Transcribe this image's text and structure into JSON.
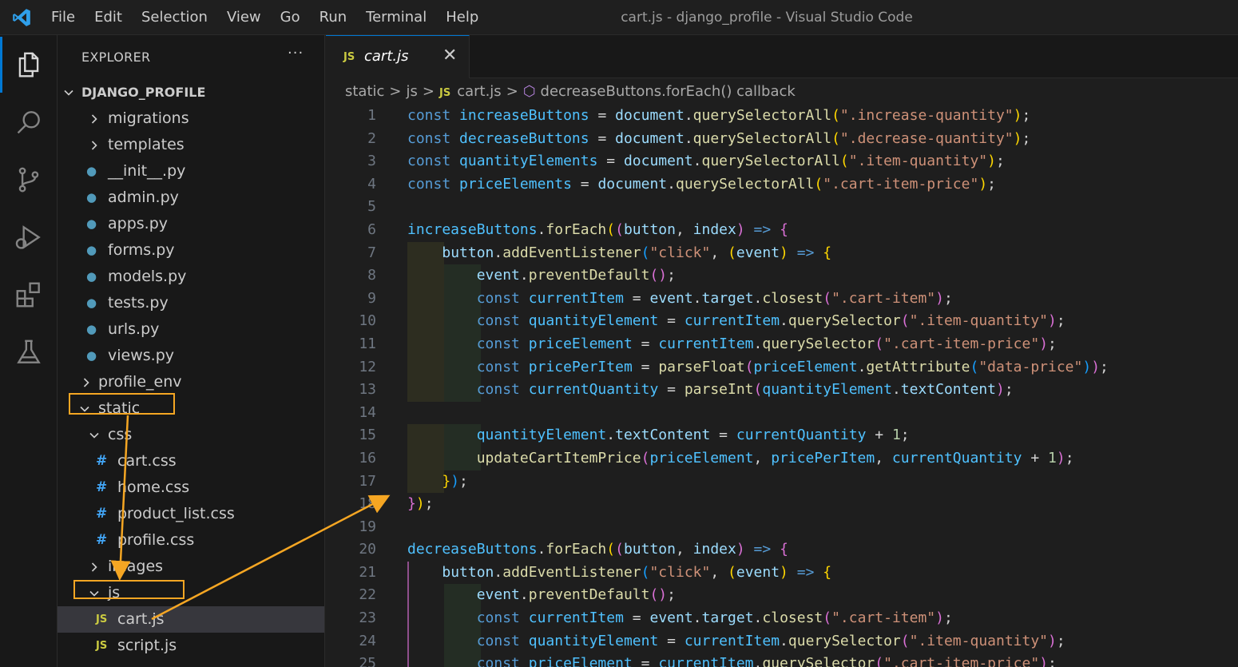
{
  "menu": [
    "File",
    "Edit",
    "Selection",
    "View",
    "Go",
    "Run",
    "Terminal",
    "Help"
  ],
  "window_title": "cart.js - django_profile - Visual Studio Code",
  "sidebar": {
    "title": "EXPLORER",
    "more": "···",
    "root": "DJANGO_PROFILE",
    "items": [
      {
        "label": "migrations",
        "type": "folder",
        "expanded": false
      },
      {
        "label": "templates",
        "type": "folder",
        "expanded": false
      },
      {
        "label": "__init__.py",
        "type": "py"
      },
      {
        "label": "admin.py",
        "type": "py"
      },
      {
        "label": "apps.py",
        "type": "py"
      },
      {
        "label": "forms.py",
        "type": "py"
      },
      {
        "label": "models.py",
        "type": "py"
      },
      {
        "label": "tests.py",
        "type": "py"
      },
      {
        "label": "urls.py",
        "type": "py"
      },
      {
        "label": "views.py",
        "type": "py"
      },
      {
        "label": "profile_env",
        "type": "folder",
        "expanded": false
      },
      {
        "label": "static",
        "type": "folder",
        "expanded": true
      },
      {
        "label": "css",
        "type": "folder",
        "expanded": true
      },
      {
        "label": "cart.css",
        "type": "css"
      },
      {
        "label": "home.css",
        "type": "css"
      },
      {
        "label": "product_list.css",
        "type": "css"
      },
      {
        "label": "profile.css",
        "type": "css"
      },
      {
        "label": "images",
        "type": "folder",
        "expanded": false
      },
      {
        "label": "js",
        "type": "folder",
        "expanded": true
      },
      {
        "label": "cart.js",
        "type": "js",
        "selected": true
      },
      {
        "label": "script.js",
        "type": "js"
      }
    ]
  },
  "icons": {
    "py": "#519aba",
    "css": "#",
    "js": "JS"
  },
  "tab": {
    "label": "cart.js",
    "close": "✕"
  },
  "breadcrumb": [
    "static",
    "js",
    "cart.js",
    "decreaseButtons.forEach() callback"
  ],
  "line_numbers": [
    "1",
    "2",
    "3",
    "4",
    "5",
    "6",
    "7",
    "8",
    "9",
    "10",
    "11",
    "12",
    "13",
    "14",
    "15",
    "16",
    "17",
    "18",
    "19",
    "20",
    "21",
    "22",
    "23",
    "24",
    "25"
  ],
  "colors": {
    "accent": "#0078d4",
    "annotation": "#f5a623"
  }
}
